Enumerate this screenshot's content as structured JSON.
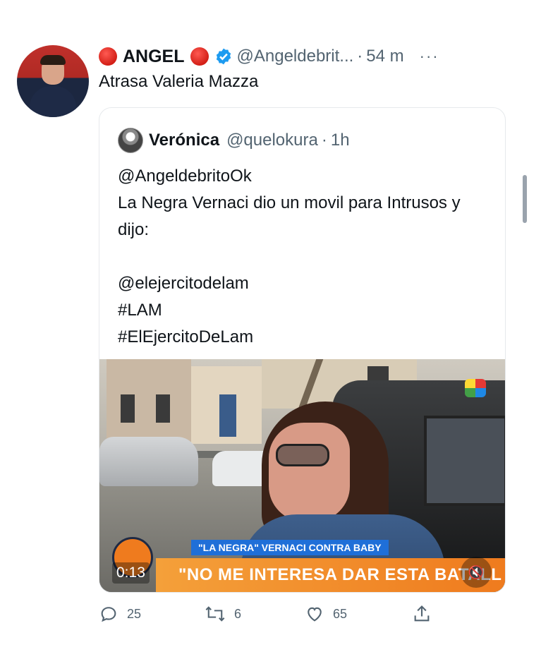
{
  "tweet": {
    "author_name": "ANGEL",
    "author_handle": "@Angeldebrit...",
    "separator": "·",
    "time": "54 m",
    "more": "···",
    "text": "Atrasa Valeria Mazza"
  },
  "quoted": {
    "name": "Verónica",
    "handle": "@quelokura",
    "separator": "·",
    "time": "1h",
    "text": "@AngeldebritoOk\nLa Negra Vernaci dio un movil para Intrusos y dijo:\n\n@elejercitodelam\n#LAM\n#ElEjercitoDeLam"
  },
  "video": {
    "lower_third_title": "\"LA NEGRA\" VERNACI CONTRA BABY",
    "lower_third_text": "\"NO ME INTERESA DAR ESTA BATALL",
    "duration": "0:13",
    "mute_icon": "speaker-mute-icon"
  },
  "actions": {
    "replies": "25",
    "retweets": "6",
    "likes": "65"
  },
  "colors": {
    "verified": "#1d9bf0",
    "red_emoji": "#d31f17",
    "secondary_text": "#536471"
  }
}
